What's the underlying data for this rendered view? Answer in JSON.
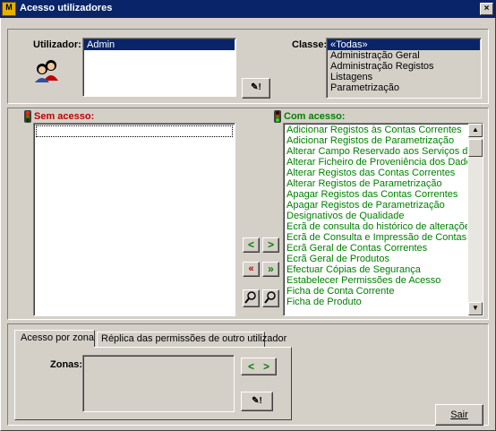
{
  "window": {
    "title": "Acesso utilizadores",
    "title_icon_glyph": "M",
    "close_glyph": "×"
  },
  "user_section": {
    "utilizador_label": "Utilizador:",
    "users": [
      "Admin"
    ],
    "edit_glyph": "✎!",
    "classe_label": "Classe:",
    "classes": [
      "«Todas»",
      "Administração Geral",
      "Administração Registos",
      "Listagens",
      "Parametrização"
    ]
  },
  "sem_acesso": {
    "label": "Sem acesso:",
    "items": []
  },
  "com_acesso": {
    "label": "Com acesso:",
    "items": [
      "Adicionar Registos às Contas Correntes",
      "Adicionar Registos de Parametrização",
      "Alterar Campo Reservado aos Serviços de Contr",
      "Alterar Ficheiro de Proveniência dos Dados",
      "Alterar Registos das Contas Correntes",
      "Alterar Registos de Parametrização",
      "Apagar Registos das Contas Correntes",
      "Apagar Registos de Parametrização",
      "Designativos de Qualidade",
      "Ecrã de consulta do histórico de alterações",
      "Ecrã de Consulta e Impressão de Contas Corrent",
      "Ecrã Geral de Contas Correntes",
      "Ecrã Geral de Produtos",
      "Efectuar Cópias de Segurança",
      "Estabelecer Permissões de Acesso",
      "Ficha de Conta Corrente",
      "Ficha de Produto"
    ],
    "scroll_up": "▲",
    "scroll_down": "▼"
  },
  "transfer_buttons": {
    "move_left": "<",
    "move_right": ">",
    "move_all_left": "«",
    "move_all_right": "»",
    "search_glyph": "⚲"
  },
  "tabs": [
    {
      "label": "Acesso por zona"
    },
    {
      "label": "Réplica das permissões de outro utilizador"
    }
  ],
  "zone_panel": {
    "zonas_label": "Zonas:",
    "left_glyph": "<",
    "right_glyph": ">",
    "edit_glyph": "✎!"
  },
  "exit_button": {
    "label": "Sair"
  },
  "colors": {
    "titlebar": "#0a246a",
    "face": "#d4d0c8",
    "selection": "#0a246a",
    "green_text": "#008000",
    "red_text": "#c00000"
  }
}
